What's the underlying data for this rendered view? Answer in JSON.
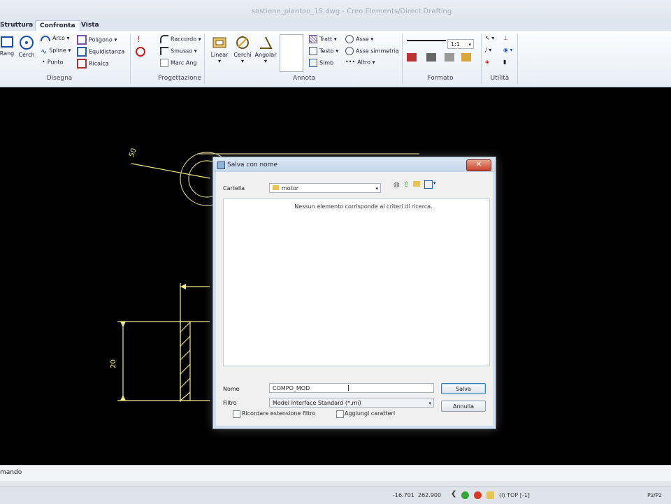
{
  "window": {
    "title": "sostiene_plantoo_15.dwg - Creo Elements/Direct Drafting"
  },
  "tabs": [
    "Struttura",
    "Confronta",
    "Vista"
  ],
  "ribbon": {
    "groups": [
      "Disegna",
      "Progettazione",
      "Annota",
      "Formato",
      "Utilità"
    ],
    "disegna": {
      "rett": "Rang",
      "cerchio": "Cerch",
      "arco": "Arco",
      "spline": "Spline",
      "punto": "Punto",
      "poligono": "Poligono",
      "equidistanza": "Equidistanza",
      "ricalca": "Ricalca"
    },
    "progettazione": {
      "raccordo": "Raccordo",
      "smusso": "Smusso",
      "marc_ang": "Marc Ang"
    },
    "annota": {
      "lineare": "Linear",
      "cerchi": "Cerchi",
      "angolare": "Angolar",
      "tratt": "Tratt",
      "testo": "Testo",
      "simb": "Simb",
      "asse": "Asse",
      "asse_simmetria": "Asse simmetria",
      "altro": "Altro"
    },
    "formato": {
      "scale": "1:1"
    }
  },
  "drawing": {
    "dim_top": "50",
    "dim_side": "20"
  },
  "dialog": {
    "title": "Salva con nome",
    "folder_label": "Cartella",
    "folder_value": "motor",
    "empty_message": "Nessun elemento corrisponde ai criteri di ricerca.",
    "name_label": "Nome",
    "name_value": "COMPO_MOD",
    "filter_label": "Filtro",
    "filter_value": "Model Interface Standard (*.mi)",
    "save_button": "Salva",
    "cancel_button": "Annulla",
    "remember_ext": "Ricordare estensione filtro",
    "add_chars": "Aggiungi caratteri"
  },
  "command_bar": {
    "label": "mando"
  },
  "status": {
    "x": "-16.701",
    "y": "262.900",
    "view": "(I) TOP [-1]",
    "right": "Pz/Pz"
  },
  "colors": {
    "canvas": "#000000",
    "geometry": "#f2e98a",
    "dialog_frame": "#cfdff0"
  }
}
